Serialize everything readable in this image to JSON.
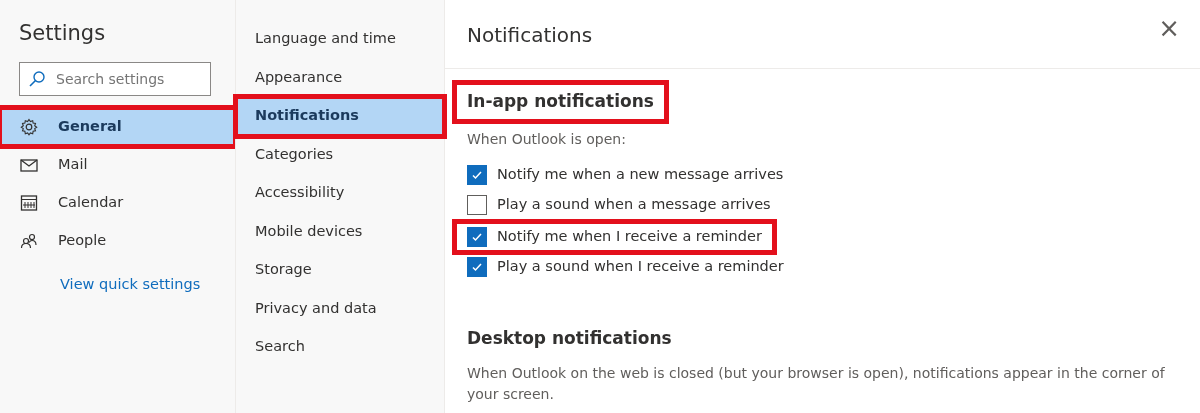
{
  "sidebar": {
    "title": "Settings",
    "search": {
      "placeholder": "Search settings"
    },
    "items": [
      {
        "label": "General",
        "selected": true,
        "highlighted": true
      },
      {
        "label": "Mail",
        "selected": false,
        "highlighted": false
      },
      {
        "label": "Calendar",
        "selected": false,
        "highlighted": false
      },
      {
        "label": "People",
        "selected": false,
        "highlighted": false
      }
    ],
    "link": "View quick settings"
  },
  "subnav": {
    "items": [
      {
        "label": "Language and time",
        "selected": false,
        "highlighted": false
      },
      {
        "label": "Appearance",
        "selected": false,
        "highlighted": false
      },
      {
        "label": "Notifications",
        "selected": true,
        "highlighted": true
      },
      {
        "label": "Categories",
        "selected": false,
        "highlighted": false
      },
      {
        "label": "Accessibility",
        "selected": false,
        "highlighted": false
      },
      {
        "label": "Mobile devices",
        "selected": false,
        "highlighted": false
      },
      {
        "label": "Storage",
        "selected": false,
        "highlighted": false
      },
      {
        "label": "Privacy and data",
        "selected": false,
        "highlighted": false
      },
      {
        "label": "Search",
        "selected": false,
        "highlighted": false
      }
    ]
  },
  "panel": {
    "title": "Notifications",
    "close": "×",
    "sections": [
      {
        "heading": "In-app notifications",
        "highlighted": true,
        "description": "When Outlook is open:",
        "options": [
          {
            "label": "Notify me when a new message arrives",
            "checked": true,
            "highlighted": false
          },
          {
            "label": "Play a sound when a message arrives",
            "checked": false,
            "highlighted": false
          },
          {
            "label": "Notify me when I receive a reminder",
            "checked": true,
            "highlighted": true
          },
          {
            "label": "Play a sound when I receive a reminder",
            "checked": true,
            "highlighted": false
          }
        ]
      },
      {
        "heading": "Desktop notifications",
        "highlighted": false,
        "description": "When Outlook on the web is closed (but your browser is open), notifications appear in the corner of your screen."
      }
    ]
  }
}
